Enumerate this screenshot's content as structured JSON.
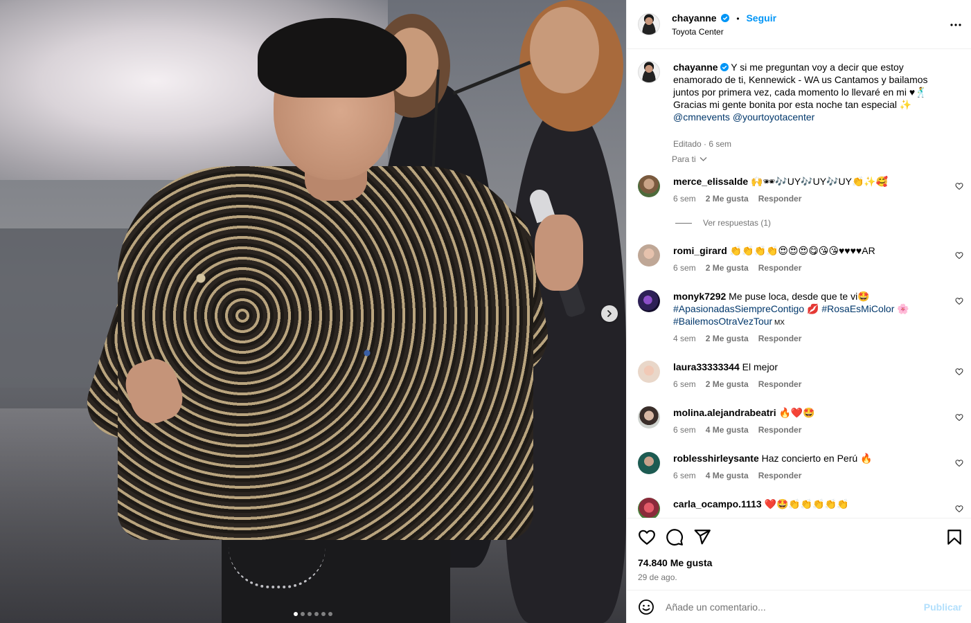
{
  "post": {
    "author": "chayanne",
    "follow_label": "Seguir",
    "separator": "•",
    "location": "Toyota Center",
    "carousel_dots": 6,
    "carousel_active": 0
  },
  "caption": {
    "username": "chayanne",
    "text": "Y si me preguntan voy a decir que estoy enamorado de ti, Kennewick - WA us Cantamos y bailamos juntos por primera vez, cada momento lo llevaré en mi ♥🕺 Gracias mi gente bonita por esta noche tan especial ✨ ",
    "mention_1": "@cmnevents",
    "mention_2": "@yourtoyotacenter",
    "edited": "Editado · 6 sem"
  },
  "filter_label": "Para ti",
  "comments": [
    {
      "username": "merce_elissalde",
      "text": "🙌🕶🎶UY🎶UY🎶UY👏✨🥰",
      "time": "6 sem",
      "likes": "2 Me gusta",
      "reply": "Responder",
      "view_replies": "Ver respuestas (1)"
    },
    {
      "username": "romi_girard",
      "text": "👏👏👏👏😍😍😍😋😘😘♥♥♥♥AR",
      "time": "6 sem",
      "likes": "2 Me gusta",
      "reply": "Responder"
    },
    {
      "username": "monyk7292",
      "text": "Me puse loca, desde que te vi🤩",
      "tag_1": "#ApasionadasSiempreContigo",
      "tag_1_emoji": " 💋 ",
      "tag_2": "#RosaEsMiColor",
      "tag_2_emoji": " 🌸",
      "tag_3": "#BailemosOtraVezTour",
      "tag_3_suffix": " MX",
      "time": "4 sem",
      "likes": "2 Me gusta",
      "reply": "Responder"
    },
    {
      "username": "laura33333344",
      "text": "El mejor",
      "time": "6 sem",
      "likes": "2 Me gusta",
      "reply": "Responder"
    },
    {
      "username": "molina.alejandrabeatri",
      "text": "🔥❤️🤩",
      "time": "6 sem",
      "likes": "4 Me gusta",
      "reply": "Responder"
    },
    {
      "username": "roblesshirleysante",
      "text": "Haz concierto en Perú 🔥",
      "time": "6 sem",
      "likes": "4 Me gusta",
      "reply": "Responder"
    },
    {
      "username": "carla_ocampo.1113",
      "text": "❤️🤩👏👏👏👏👏"
    }
  ],
  "stats": {
    "likes": "74.840 Me gusta",
    "date": "29 de ago."
  },
  "composer": {
    "placeholder": "Añade un comentario...",
    "publish_label": "Publicar"
  },
  "icons": {
    "verified": "verified-badge-icon",
    "more": "more-options-icon",
    "like": "heart-icon",
    "comment": "comment-icon",
    "share": "share-icon",
    "save": "bookmark-icon",
    "emoji": "emoji-icon",
    "next": "chevron-right-icon"
  },
  "colors": {
    "accent": "#0095f6",
    "link": "#00376b",
    "muted": "#737373",
    "publish_disabled": "#b2dffc"
  }
}
